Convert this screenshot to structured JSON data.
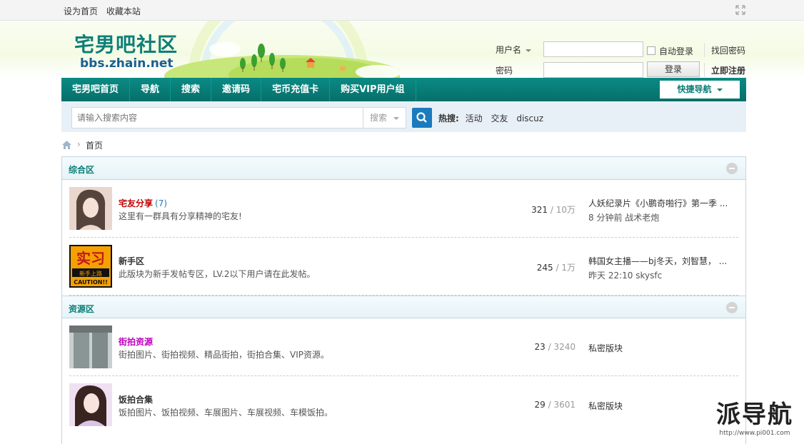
{
  "topbar": {
    "set_home": "设为首页",
    "bookmark": "收藏本站"
  },
  "header": {
    "logo_name": "宅男吧社区",
    "logo_domain": "bbs.zhain.net"
  },
  "login": {
    "username_label": "用户名",
    "password_label": "密码",
    "username_value": "",
    "password_value": "",
    "auto_login": "自动登录",
    "forgot": "找回密码",
    "login_button": "登录",
    "register": "立即注册"
  },
  "nav": {
    "items": [
      "宅男吧首页",
      "导航",
      "搜索",
      "邀请码",
      "宅币充值卡",
      "购买VIP用户组"
    ],
    "quick": "快捷导航"
  },
  "search": {
    "placeholder": "请输入搜索内容",
    "type": "搜索",
    "hot_label": "热搜:",
    "hot_items": [
      "活动",
      "交友",
      "discuz"
    ]
  },
  "breadcrumb": {
    "current": "首页"
  },
  "categories": [
    {
      "title": "综合区",
      "forums": [
        {
          "name": "宅友分享",
          "count": "(7)",
          "desc": "这里有一群具有分享精神的宅友!",
          "threads": "321",
          "posts": "10万",
          "last_title": "人妖纪录片《小鹏奇啪行》第一季 ...",
          "last_meta": "8 分钟前 战术老炮",
          "name_color": "#c00000"
        },
        {
          "name": "新手区",
          "count": "",
          "desc": "此版块为新手发帖专区，LV.2以下用户请在此发帖。",
          "threads": "245",
          "posts": "1万",
          "last_title": "韩国女主播——bj冬天，刘智慧， ...",
          "last_meta": "昨天 22:10 skysfc",
          "name_color": "#333333"
        }
      ]
    },
    {
      "title": "资源区",
      "forums": [
        {
          "name": "街拍资源",
          "count": "",
          "desc": "街拍图片、街拍视频、精品街拍，街拍合集、VIP资源。",
          "threads": "23",
          "posts": "3240",
          "last_title": "私密版块",
          "last_meta": "",
          "name_color": "#c000c0"
        },
        {
          "name": "饭拍合集",
          "count": "",
          "desc": "饭拍图片、饭拍视频、车展图片、车展视频、车模饭拍。",
          "threads": "29",
          "posts": "3601",
          "last_title": "私密版块",
          "last_meta": "",
          "name_color": "#333333"
        }
      ]
    }
  ],
  "thumb_labels": {
    "practice_big": "实习",
    "practice_mid": "新手上路",
    "practice_small": "CAUTION!!"
  },
  "watermark": {
    "big": "派导航",
    "small": "http://www.pi001.com"
  },
  "colors": {
    "nav": "#0a7d77",
    "search_btn": "#1b7bbd",
    "category_title": "#0a7d77"
  }
}
